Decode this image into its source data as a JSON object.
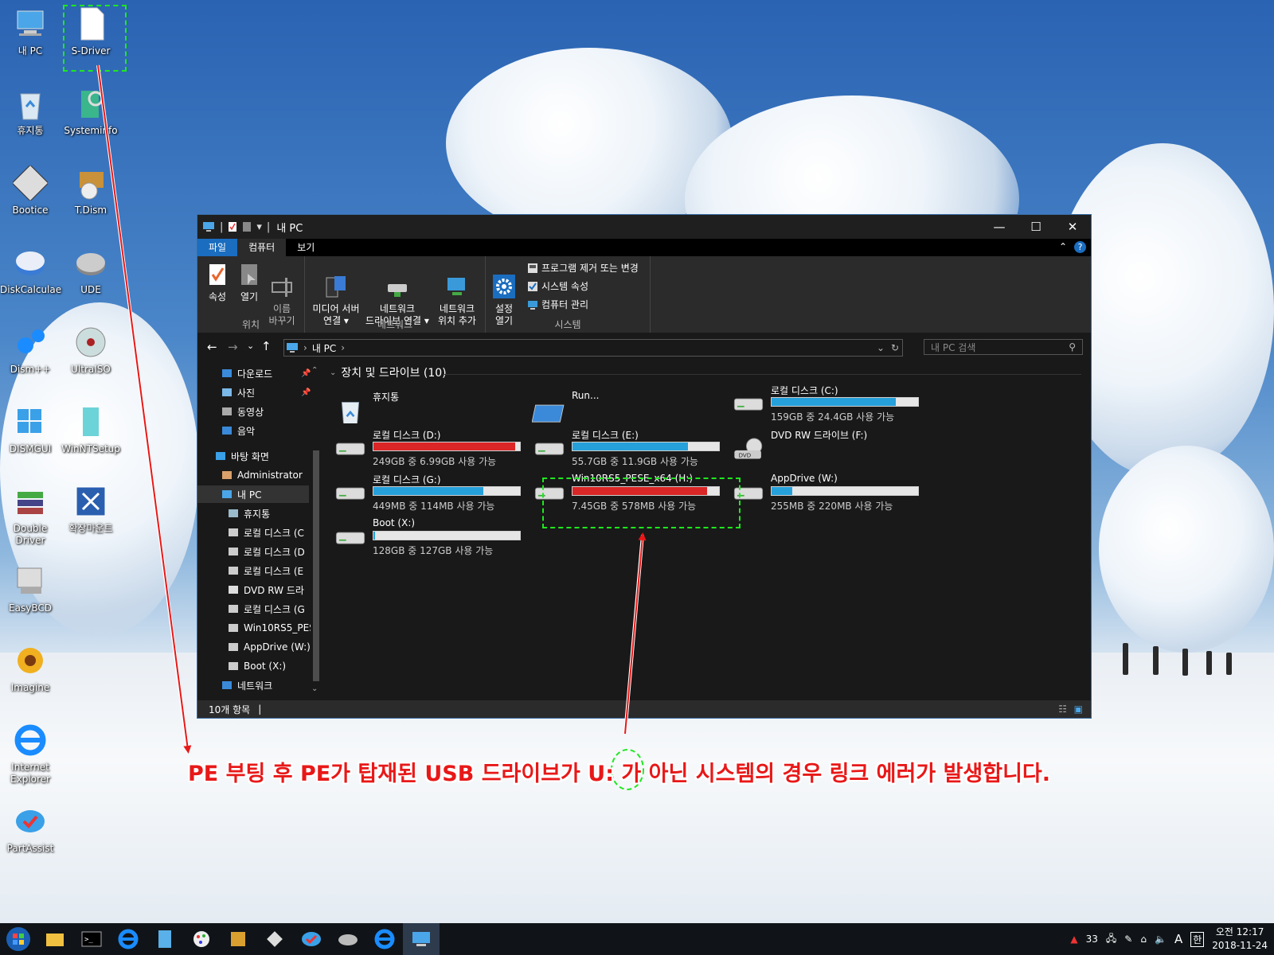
{
  "desktop": {
    "icons": [
      {
        "label": "내 PC",
        "icon": "computer-icon"
      },
      {
        "label": "S-Driver",
        "icon": "blank-file-icon"
      },
      {
        "label": "휴지통",
        "icon": "recycle-bin-icon"
      },
      {
        "label": "Systeminfo",
        "icon": "systeminfo-icon"
      },
      {
        "label": "Bootice",
        "icon": "bootice-icon"
      },
      {
        "label": "T.Dism",
        "icon": "tdism-icon"
      },
      {
        "label": "DiskCalculae",
        "icon": "disk-calculator-icon"
      },
      {
        "label": "UDE",
        "icon": "ude-icon"
      },
      {
        "label": "Dism++",
        "icon": "dism-plus-icon"
      },
      {
        "label": "UltraISO",
        "icon": "ultraiso-icon"
      },
      {
        "label": "DISMGUI",
        "icon": "dismgui-icon"
      },
      {
        "label": "WinNTSetup",
        "icon": "winntsetup-icon"
      },
      {
        "label": "Double Driver",
        "icon": "double-driver-icon"
      },
      {
        "label": "확장마운트",
        "icon": "expand-mount-icon"
      },
      {
        "label": "EasyBCD",
        "icon": "easybcd-icon"
      },
      {
        "label": "Imagine",
        "icon": "imagine-icon"
      },
      {
        "label": "Internet Explorer",
        "icon": "internet-explorer-icon"
      },
      {
        "label": "PartAssist",
        "icon": "partassist-icon"
      }
    ]
  },
  "annotation": {
    "text": "PE 부팅 후 PE가 탑재된 USB 드라이브가 U: 가 아닌 시스템의 경우 링크 에러가 발생합니다.",
    "color": "#e81818",
    "highlight_color": "#1ee81e"
  },
  "window": {
    "title": "내 PC",
    "tabs": [
      "파일",
      "컴퓨터",
      "보기"
    ],
    "ribbon": {
      "location": {
        "name": "위치",
        "buttons": [
          "속성",
          "열기",
          "이름\n바꾸기"
        ]
      },
      "network": {
        "name": "네트워크",
        "buttons": [
          "미디어 서버\n연결 ▾",
          "네트워크\n드라이브 연결 ▾",
          "네트워크\n위치 추가"
        ]
      },
      "system": {
        "name": "시스템",
        "settings": "설정\n열기",
        "items": [
          "프로그램 제거 또는 변경",
          "시스템 속성",
          "컴퓨터 관리"
        ]
      }
    },
    "address": {
      "path": "내 PC",
      "search_placeholder": "내 PC 검색"
    },
    "nav": [
      {
        "label": "다운로드",
        "icon": "download-icon",
        "pinned": true
      },
      {
        "label": "사진",
        "icon": "pictures-icon",
        "pinned": true
      },
      {
        "label": "동영상",
        "icon": "video-icon"
      },
      {
        "label": "음악",
        "icon": "music-icon"
      },
      {
        "label": "바탕 화면",
        "icon": "desktop-icon"
      },
      {
        "label": "Administrator",
        "icon": "user-icon"
      },
      {
        "label": "내 PC",
        "icon": "computer-icon"
      },
      {
        "label": "휴지통",
        "icon": "recycle-bin-icon"
      },
      {
        "label": "로컬 디스크 (C",
        "icon": "drive-icon"
      },
      {
        "label": "로컬 디스크 (D",
        "icon": "drive-icon"
      },
      {
        "label": "로컬 디스크 (E",
        "icon": "drive-icon"
      },
      {
        "label": "DVD RW 드라",
        "icon": "dvd-icon"
      },
      {
        "label": "로컬 디스크 (G",
        "icon": "drive-icon"
      },
      {
        "label": "Win10RS5_PES",
        "icon": "drive-icon"
      },
      {
        "label": "AppDrive (W:)",
        "icon": "drive-icon"
      },
      {
        "label": "Boot (X:)",
        "icon": "drive-icon"
      },
      {
        "label": "네트워크",
        "icon": "network-icon"
      }
    ],
    "section_title": "장치 및 드라이브 (10)",
    "drives": [
      {
        "name": "휴지통",
        "kind": "recycle"
      },
      {
        "name": "Run...",
        "kind": "run"
      },
      {
        "name": "로컬 디스크 (C:)",
        "info": "159GB 중 24.4GB 사용 가능",
        "used": 0.85,
        "color": "#26a0da"
      },
      {
        "name": "로컬 디스크 (D:)",
        "info": "249GB 중 6.99GB 사용 가능",
        "used": 0.97,
        "color": "#da2626"
      },
      {
        "name": "로컬 디스크 (E:)",
        "info": "55.7GB 중 11.9GB 사용 가능",
        "used": 0.79,
        "color": "#26a0da"
      },
      {
        "name": "DVD RW 드라이브 (F:)",
        "kind": "dvd"
      },
      {
        "name": "로컬 디스크 (G:)",
        "info": "449MB 중 114MB 사용 가능",
        "used": 0.75,
        "color": "#26a0da"
      },
      {
        "name": "Win10RS5_PESE_x64 (H:)",
        "info": "7.45GB 중 578MB 사용 가능",
        "used": 0.92,
        "color": "#da2626"
      },
      {
        "name": "AppDrive (W:)",
        "info": "255MB 중 220MB 사용 가능",
        "used": 0.14,
        "color": "#26a0da"
      },
      {
        "name": "Boot (X:)",
        "info": "128GB 중 127GB 사용 가능",
        "used": 0.01,
        "color": "#26a0da"
      }
    ],
    "status": "10개 항목"
  },
  "taskbar": {
    "apps": [
      "start-icon",
      "file-explorer-icon",
      "cmd-icon",
      "internet-explorer-icon",
      "notepad-icon",
      "paint-icon",
      "registry-icon",
      "bootice-icon",
      "partassist-icon",
      "ude-icon",
      "internet-explorer-icon",
      "this-pc-icon"
    ],
    "tray": {
      "battery_text": "33",
      "ime": "A",
      "lang": "한",
      "time": "오전 12:17",
      "date": "2018-11-24"
    }
  }
}
